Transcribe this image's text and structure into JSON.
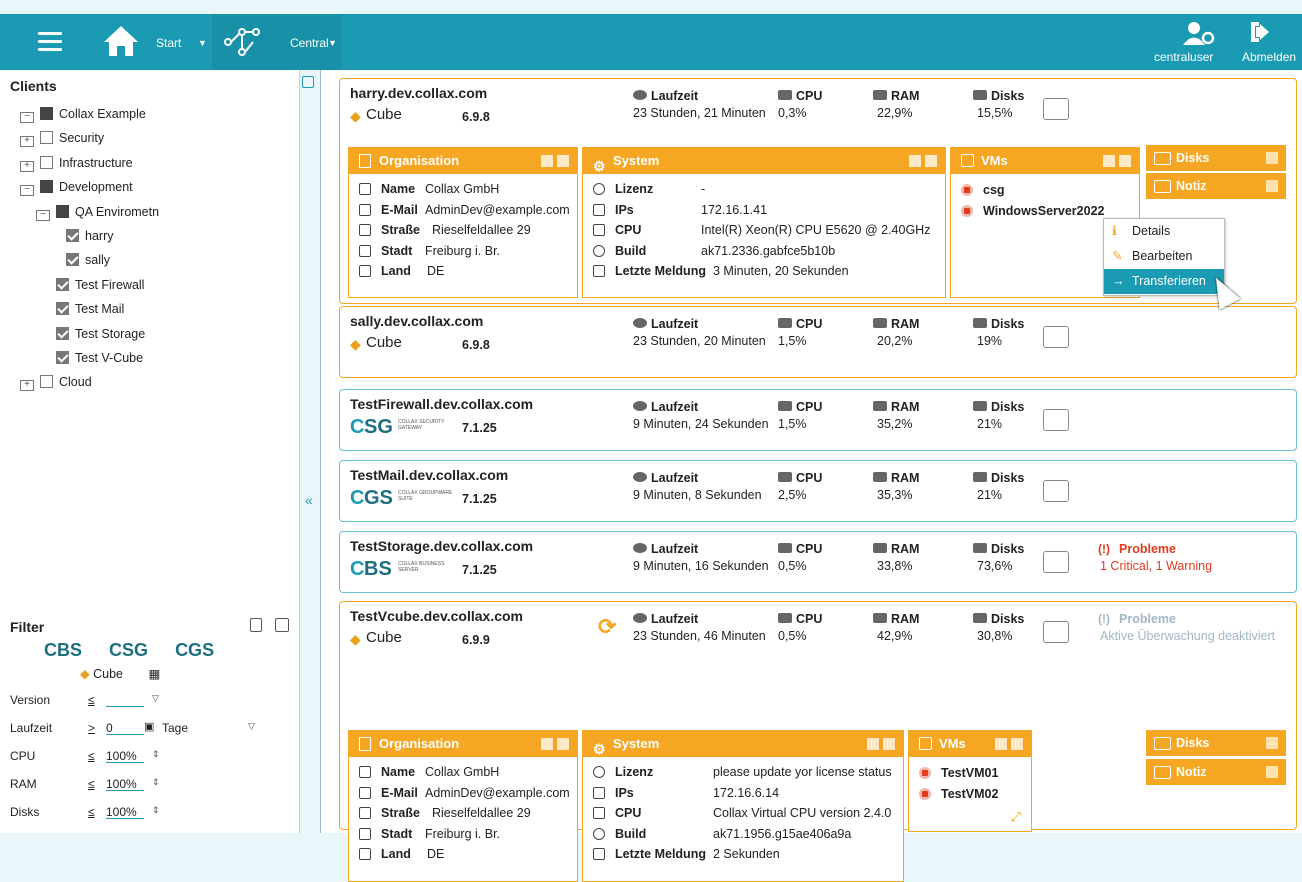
{
  "topbar": {
    "start": "Start",
    "central": "Central",
    "user": "centraluser",
    "logout": "Abmelden"
  },
  "sidebar": {
    "clients_title": "Clients",
    "tree": [
      {
        "label": "Collax Example",
        "indent": 0,
        "toggle": "−",
        "box": "fill"
      },
      {
        "label": "Security",
        "indent": 0,
        "toggle": "+",
        "box": "empty"
      },
      {
        "label": "Infrastructure",
        "indent": 0,
        "toggle": "+",
        "box": "empty"
      },
      {
        "label": "Development",
        "indent": 0,
        "toggle": "−",
        "box": "fill"
      },
      {
        "label": "QA Envirometn",
        "indent": 1,
        "toggle": "−",
        "box": "fill"
      },
      {
        "label": "harry",
        "indent": 2,
        "toggle": "",
        "box": "chk"
      },
      {
        "label": "sally",
        "indent": 2,
        "toggle": "",
        "box": "chk"
      },
      {
        "label": "Test Firewall",
        "indent": 3,
        "toggle": "",
        "box": "chk"
      },
      {
        "label": "Test Mail",
        "indent": 3,
        "toggle": "",
        "box": "chk"
      },
      {
        "label": "Test Storage",
        "indent": 3,
        "toggle": "",
        "box": "chk"
      },
      {
        "label": "Test V-Cube",
        "indent": 3,
        "toggle": "",
        "box": "chk"
      },
      {
        "label": "Cloud",
        "indent": 0,
        "toggle": "+",
        "box": "empty"
      }
    ],
    "filter_title": "Filter",
    "filter_logos": [
      "CBS",
      "CSG",
      "CGS",
      "Cube"
    ],
    "filters": [
      {
        "label": "Version",
        "op": "≤",
        "value": ""
      },
      {
        "label": "Laufzeit",
        "op": ">",
        "value": "0",
        "suffix": "Tage"
      },
      {
        "label": "CPU",
        "op": "≤",
        "value": "100%"
      },
      {
        "label": "RAM",
        "op": "≤",
        "value": "100%"
      },
      {
        "label": "Disks",
        "op": "≤",
        "value": "100%"
      }
    ]
  },
  "metric_labels": {
    "uptime": "Laufzeit",
    "cpu": "CPU",
    "ram": "RAM",
    "disks": "Disks",
    "problems": "Probleme"
  },
  "hosts": [
    {
      "name": "harry.dev.collax.com",
      "product": "Cube",
      "version": "6.9.8",
      "uptime": "23 Stunden, 21 Minuten",
      "cpu": "0,3%",
      "ram": "22,9%",
      "disks": "15,5%"
    },
    {
      "name": "sally.dev.collax.com",
      "product": "Cube",
      "version": "6.9.8",
      "uptime": "23 Stunden, 20 Minuten",
      "cpu": "1,5%",
      "ram": "20,2%",
      "disks": "19%"
    },
    {
      "name": "TestFirewall.dev.collax.com",
      "product": "SG",
      "version": "7.1.25",
      "uptime": "9 Minuten, 24 Sekunden",
      "cpu": "1,5%",
      "ram": "35,2%",
      "disks": "21%"
    },
    {
      "name": "TestMail.dev.collax.com",
      "product": "GS",
      "version": "7.1.25",
      "uptime": "9 Minuten, 8 Sekunden",
      "cpu": "2,5%",
      "ram": "35,3%",
      "disks": "21%"
    },
    {
      "name": "TestStorage.dev.collax.com",
      "product": "BS",
      "version": "7.1.25",
      "uptime": "9 Minuten, 16 Sekunden",
      "cpu": "0,5%",
      "ram": "33,8%",
      "disks": "73,6%",
      "problem": "1 Critical, 1 Warning"
    },
    {
      "name": "TestVcube.dev.collax.com",
      "product": "Cube",
      "version": "6.9.9",
      "uptime": "23 Stunden, 46 Minuten",
      "cpu": "0,5%",
      "ram": "42,9%",
      "disks": "30,8%",
      "problem": "Aktive Überwachung deaktiviert"
    }
  ],
  "product_sub": {
    "SG": "COLLAX SECURITY GATEWAY",
    "GS": "COLLAX GROUPWARE SUITE",
    "BS": "COLLAX BUSINESS SERVER"
  },
  "panels": {
    "org": "Organisation",
    "system": "System",
    "vms": "VMs",
    "disks": "Disks",
    "note": "Notiz"
  },
  "org_keys": [
    "Name",
    "E-Mail",
    "Straße",
    "Stadt",
    "Land"
  ],
  "sys_keys": [
    "Lizenz",
    "IPs",
    "CPU",
    "Build",
    "Letzte Meldung"
  ],
  "detail1": {
    "org": [
      "Collax GmbH",
      "AdminDev@example.com",
      "Rieselfeldallee 29",
      "Freiburg i. Br.",
      "DE"
    ],
    "sys": [
      "-",
      "172.16.1.41",
      "Intel(R) Xeon(R) CPU E5620 @ 2.40GHz",
      "ak71.2336.gabfce5b10b",
      "3 Minuten, 20 Sekunden"
    ],
    "vms": [
      "csg",
      "WindowsServer2022"
    ]
  },
  "detail2": {
    "org": [
      "Collax GmbH",
      "AdminDev@example.com",
      "Rieselfeldallee 29",
      "Freiburg i. Br.",
      "DE"
    ],
    "sys": [
      "please update yor license status",
      "172.16.6.14",
      "Collax Virtual CPU version 2.4.0",
      "ak71.1956.g15ae406a9a",
      "2 Sekunden"
    ],
    "vms": [
      "TestVM01",
      "TestVM02"
    ]
  },
  "context_menu": [
    "Details",
    "Bearbeiten",
    "Transferieren"
  ],
  "colors": {
    "accent": "#1a9bb3",
    "orange": "#f5a623",
    "critical": "#e03b1d"
  }
}
